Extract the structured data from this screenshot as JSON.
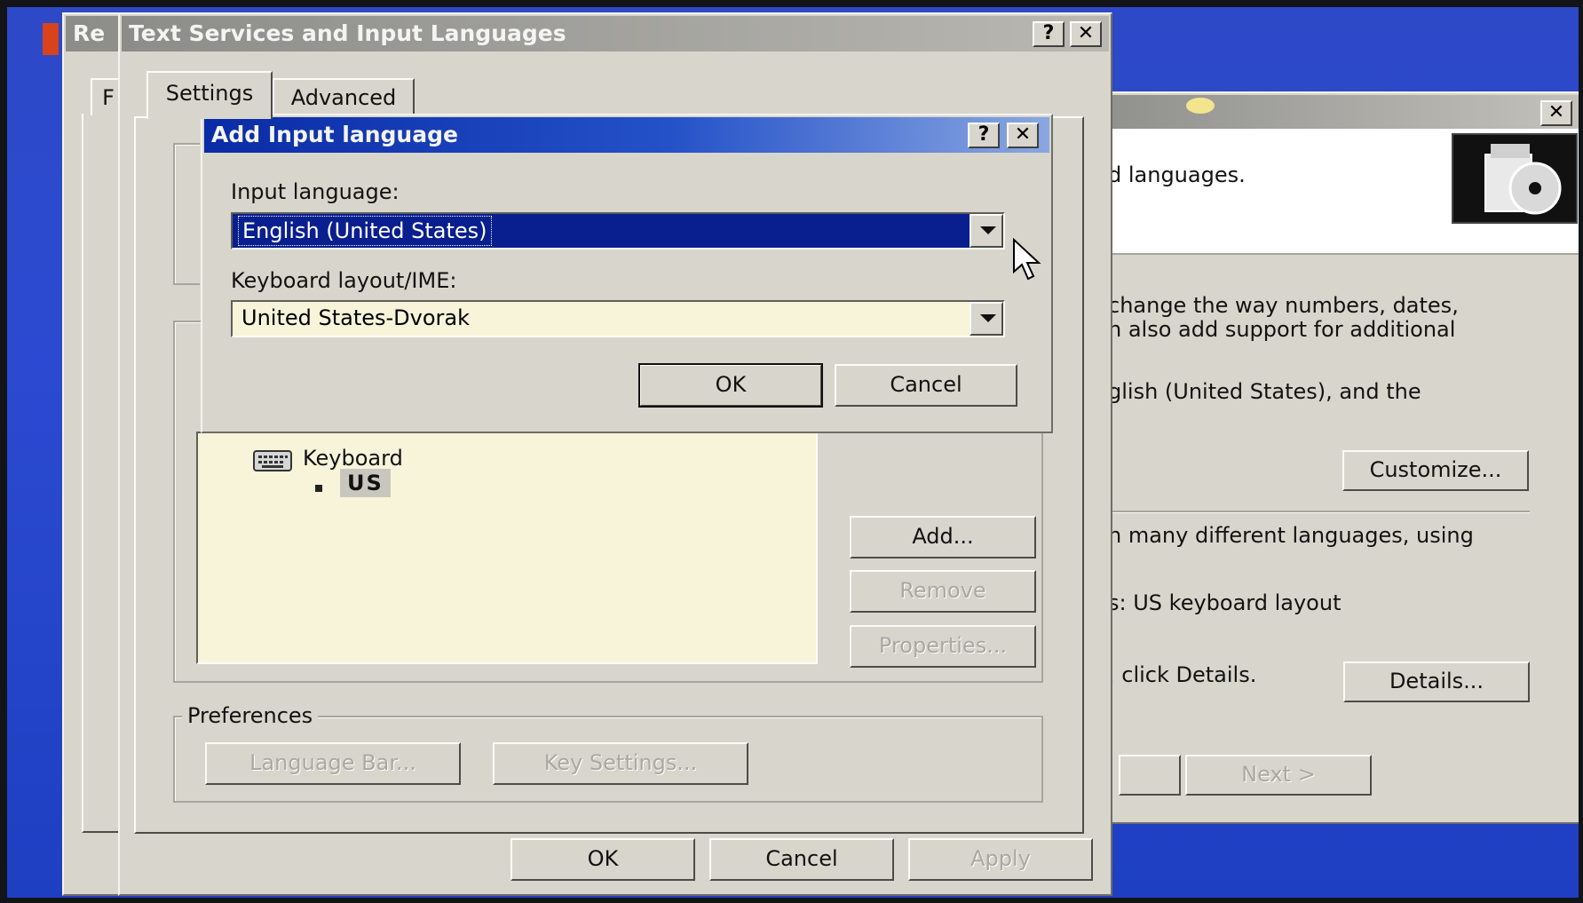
{
  "background_dialog": {
    "title": "Re",
    "tab_partial": "F"
  },
  "wizard": {
    "intro_text": "d languages.",
    "para1_line1": "change the way numbers, dates,",
    "para1_line2": "n also add support for additional",
    "para2": "glish (United States), and the",
    "customize_label": "Customize...",
    "para3": "n many different languages, using",
    "para4": "s: US keyboard layout",
    "para5": ". click Details.",
    "details_label": "Details...",
    "next_label": "Next >"
  },
  "text_services": {
    "title": "Text Services and Input Languages",
    "tabs": [
      "Settings",
      "Advanced"
    ],
    "keyboard_label": "Keyboard",
    "keyboard_item": "US",
    "add_label": "Add...",
    "remove_label": "Remove",
    "properties_label": "Properties...",
    "preferences_label": "Preferences",
    "language_bar_label": "Language Bar...",
    "key_settings_label": "Key Settings...",
    "ok_label": "OK",
    "cancel_label": "Cancel",
    "apply_label": "Apply"
  },
  "add_input_language": {
    "title": "Add Input language",
    "input_language_label": "Input language:",
    "input_language_value": "English (United States)",
    "keyboard_layout_label": "Keyboard layout/IME:",
    "keyboard_layout_value": "United States-Dvorak",
    "ok_label": "OK",
    "cancel_label": "Cancel"
  },
  "title_buttons": {
    "help": "?",
    "close": "✕"
  },
  "colors": {
    "desktop": "#2b4ad1",
    "active_title": "#0a2ba6",
    "dialog_face": "#d8d6cc",
    "list_background": "#f7f4da",
    "selection": "#0a1f8f"
  }
}
